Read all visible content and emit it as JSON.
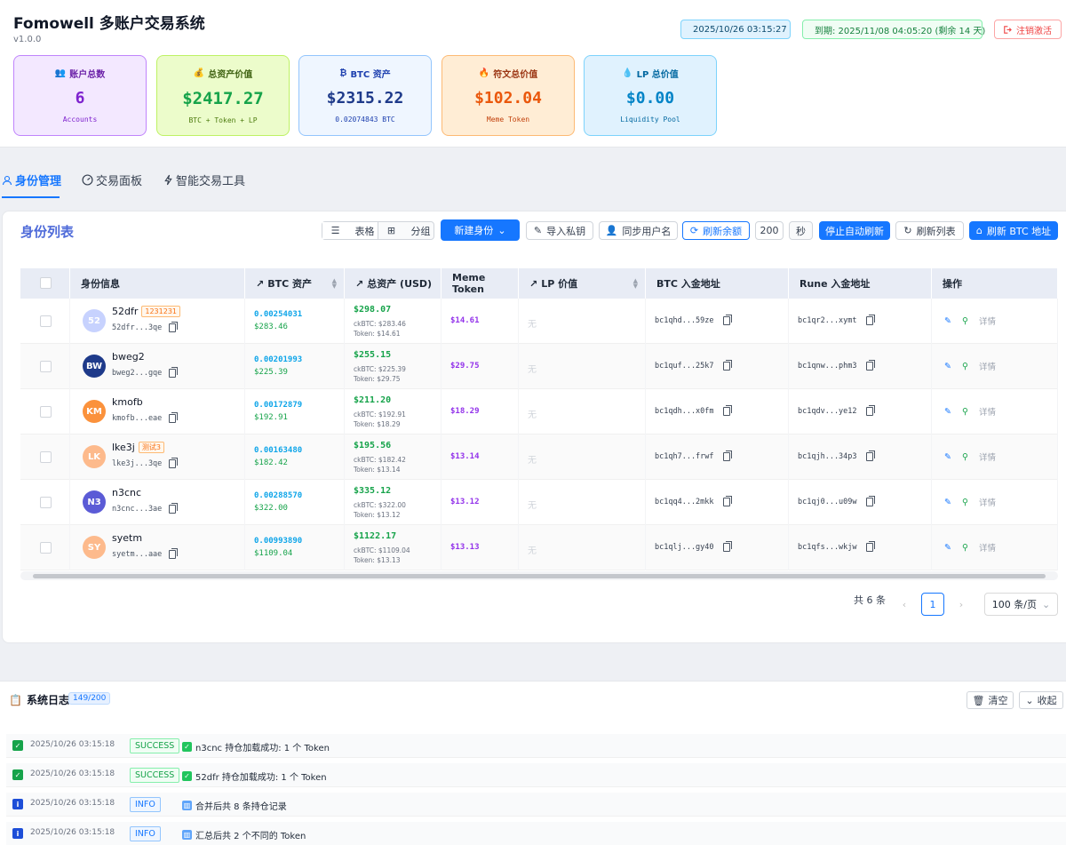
{
  "app": {
    "title": "Fomowell 多账户交易系统",
    "version": "v1.0.0"
  },
  "header": {
    "time": "2025/10/26 03:15:27",
    "expire": "到期: 2025/11/08 04:05:20 (剩余 14 天)",
    "logout": "注销激活"
  },
  "stats": [
    {
      "label": "账户总数",
      "value": "6",
      "sub": "Accounts"
    },
    {
      "label": "总资产价值",
      "value": "$2417.27",
      "sub": "BTC + Token + LP"
    },
    {
      "label": "BTC 资产",
      "value": "$2315.22",
      "sub": "0.02074843 BTC"
    },
    {
      "label": "符文总价值",
      "value": "$102.04",
      "sub": "Meme Token"
    },
    {
      "label": "LP 总价值",
      "value": "$0.00",
      "sub": "Liquidity Pool"
    }
  ],
  "tabs": [
    {
      "label": "身份管理"
    },
    {
      "label": "交易面板"
    },
    {
      "label": "智能交易工具"
    }
  ],
  "card": {
    "title": "身份列表",
    "view_table": "表格",
    "view_group": "分组",
    "new_identity": "新建身份",
    "import_key": "导入私钥",
    "sync_user": "同步用户名",
    "refresh_balance": "刷新余额",
    "interval_value": "200",
    "interval_unit": "秒",
    "stop_auto": "停止自动刷新",
    "refresh_list": "刷新列表",
    "refresh_btc": "刷新 BTC 地址"
  },
  "table": {
    "headers": [
      "身份信息",
      "BTC 资产",
      "总资产 (USD)",
      "Meme Token",
      "LP 价值",
      "BTC 入金地址",
      "Rune 入金地址",
      "操作"
    ],
    "action_detail": "详情",
    "rows": [
      {
        "initials": "52",
        "name": "52dfr",
        "tag": "1231231",
        "addr": "52dfr...3qe",
        "btc": "0.00254031",
        "btc_usd": "$283.46",
        "total": "$298.07",
        "ckbtc": "ckBTC: $283.46",
        "token": "Token: $14.61",
        "meme": "$14.61",
        "lp": "无",
        "btc_addr": "bc1qhd...59ze",
        "rune_addr": "bc1qr2...xymt",
        "color": "#c7d2fe"
      },
      {
        "initials": "BW",
        "name": "bweg2",
        "tag": "",
        "addr": "bweg2...gqe",
        "btc": "0.00201993",
        "btc_usd": "$225.39",
        "total": "$255.15",
        "ckbtc": "ckBTC: $225.39",
        "token": "Token: $29.75",
        "meme": "$29.75",
        "lp": "无",
        "btc_addr": "bc1quf...25k7",
        "rune_addr": "bc1qnw...phm3",
        "color": "#1e3a8a"
      },
      {
        "initials": "KM",
        "name": "kmofb",
        "tag": "",
        "addr": "kmofb...eae",
        "btc": "0.00172879",
        "btc_usd": "$192.91",
        "total": "$211.20",
        "ckbtc": "ckBTC: $192.91",
        "token": "Token: $18.29",
        "meme": "$18.29",
        "lp": "无",
        "btc_addr": "bc1qdh...x0fm",
        "rune_addr": "bc1qdv...ye12",
        "color": "#fb923c"
      },
      {
        "initials": "LK",
        "name": "lke3j",
        "tag": "测试3",
        "addr": "lke3j...3qe",
        "btc": "0.00163480",
        "btc_usd": "$182.42",
        "total": "$195.56",
        "ckbtc": "ckBTC: $182.42",
        "token": "Token: $13.14",
        "meme": "$13.14",
        "lp": "无",
        "btc_addr": "bc1qh7...frwf",
        "rune_addr": "bc1qjh...34p3",
        "color": "#fdba8c"
      },
      {
        "initials": "N3",
        "name": "n3cnc",
        "tag": "",
        "addr": "n3cnc...3ae",
        "btc": "0.00288570",
        "btc_usd": "$322.00",
        "total": "$335.12",
        "ckbtc": "ckBTC: $322.00",
        "token": "Token: $13.12",
        "meme": "$13.12",
        "lp": "无",
        "btc_addr": "bc1qq4...2mkk",
        "rune_addr": "bc1qj0...u09w",
        "color": "#5b5bd6"
      },
      {
        "initials": "SY",
        "name": "syetm",
        "tag": "",
        "addr": "syetm...aae",
        "btc": "0.00993890",
        "btc_usd": "$1109.04",
        "total": "$1122.17",
        "ckbtc": "ckBTC: $1109.04",
        "token": "Token: $13.13",
        "meme": "$13.13",
        "lp": "无",
        "btc_addr": "bc1qlj...gy40",
        "rune_addr": "bc1qfs...wkjw",
        "color": "#fdba8c"
      }
    ]
  },
  "pagination": {
    "total": "共 6 条",
    "page": "1",
    "page_size": "100 条/页"
  },
  "log": {
    "title": "系统日志",
    "count": "149/200",
    "clear": "清空",
    "collapse": "收起",
    "entries": [
      {
        "time": "2025/10/26 03:15:18",
        "level": "SUCCESS",
        "msg": "n3cnc 持仓加载成功: 1 个 Token"
      },
      {
        "time": "2025/10/26 03:15:18",
        "level": "SUCCESS",
        "msg": "52dfr 持仓加载成功: 1 个 Token"
      },
      {
        "time": "2025/10/26 03:15:18",
        "level": "INFO",
        "msg": "合并后共 8 条持仓记录"
      },
      {
        "time": "2025/10/26 03:15:18",
        "level": "INFO",
        "msg": "汇总后共 2 个不同的 Token"
      }
    ]
  }
}
